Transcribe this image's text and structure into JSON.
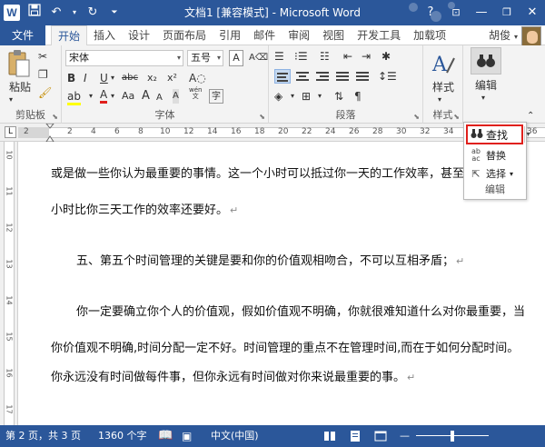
{
  "titlebar": {
    "app_icon": "W",
    "title": "文档1 [兼容模式] - Microsoft Word",
    "help": "?",
    "icons": [
      "word-logo-icon",
      "save-icon",
      "undo-icon",
      "redo-icon",
      "customize-qat-icon",
      "ribbon-display-icon",
      "minimize-icon",
      "restore-icon",
      "close-icon"
    ]
  },
  "tabs": {
    "file": "文件",
    "items": [
      "开始",
      "插入",
      "设计",
      "页面布局",
      "引用",
      "邮件",
      "审阅",
      "视图",
      "开发工具",
      "加载项"
    ],
    "active": "开始",
    "user": "胡俊"
  },
  "ribbon": {
    "clipboard": {
      "label": "剪贴板",
      "paste": "粘贴"
    },
    "font": {
      "label": "字体",
      "font_name": "宋体",
      "font_size": "五号",
      "wen": "A",
      "abc": "abc",
      "sub": "x₂",
      "sup": "x²",
      "aa": "Aa",
      "grow": "A",
      "shrink": "A",
      "bold": "B",
      "italic": "I",
      "underline": "U",
      "font_color": "A",
      "pinyin": "wén"
    },
    "paragraph": {
      "label": "段落"
    },
    "styles": {
      "label": "样式",
      "btn": "样式"
    },
    "editing": {
      "label": "编辑"
    }
  },
  "ruler": {
    "numbers": [
      "2",
      "2",
      "4",
      "6",
      "8",
      "10",
      "12",
      "14",
      "16",
      "18",
      "20",
      "22",
      "24",
      "26",
      "28",
      "30",
      "32",
      "34",
      "36"
    ],
    "vnumbers": [
      "10",
      "11",
      "12",
      "13",
      "14",
      "15",
      "16",
      "17"
    ]
  },
  "document": {
    "lines": [
      "或是做一些你认为最重要的事情。这一个小时可以抵过你一天的工作效率，甚至有",
      "小时比你三天工作的效率还要好。",
      "五、第五个时间管理的关键是要和你的价值观相吻合，不可以互相矛盾；",
      "你一定要确立你个人的价值观，假如价值观不明确，你就很难知道什么对你最重要，当",
      "你价值观不明确,时间分配一定不好。时间管理的重点不在管理时间,而在于如何分配时间。",
      "你永远没有时间做每件事，但你永远有时间做对你来说最重要的事。"
    ],
    "para_mark": "↵"
  },
  "edit_dropdown": {
    "find": "查找",
    "replace": "替换",
    "select": "选择",
    "label": "编辑"
  },
  "statusbar": {
    "page": "第 2 页，共 3 页",
    "words": "1360 个字",
    "language": "中文(中国)"
  }
}
